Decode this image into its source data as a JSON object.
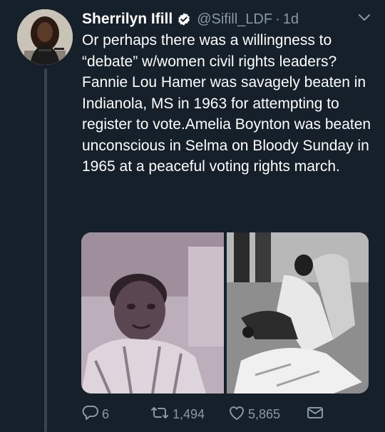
{
  "tweet": {
    "author_name": "Sherrilyn Ifill",
    "handle": "@Sifill_LDF",
    "separator": "·",
    "time": "1d",
    "text": "Or perhaps there was a willingness to “debate” w/women civil rights leaders? Fannie Lou Hamer was savagely beaten in Indianola, MS in 1963 for attempting to register to vote.Amelia Boynton was beaten unconscious in Selma on Bloody Sunday in 1965 at a peaceful voting rights march."
  },
  "actions": {
    "replies": "6",
    "retweets": "1,494",
    "likes": "5,865"
  },
  "icons": {
    "verified": "verified-badge-icon",
    "caret": "chevron-down-icon",
    "reply": "reply-icon",
    "retweet": "retweet-icon",
    "like": "heart-icon",
    "dm": "mail-icon"
  },
  "colors": {
    "background": "#15202b",
    "secondary_text": "#8899a6",
    "thread_line": "#38444d"
  }
}
